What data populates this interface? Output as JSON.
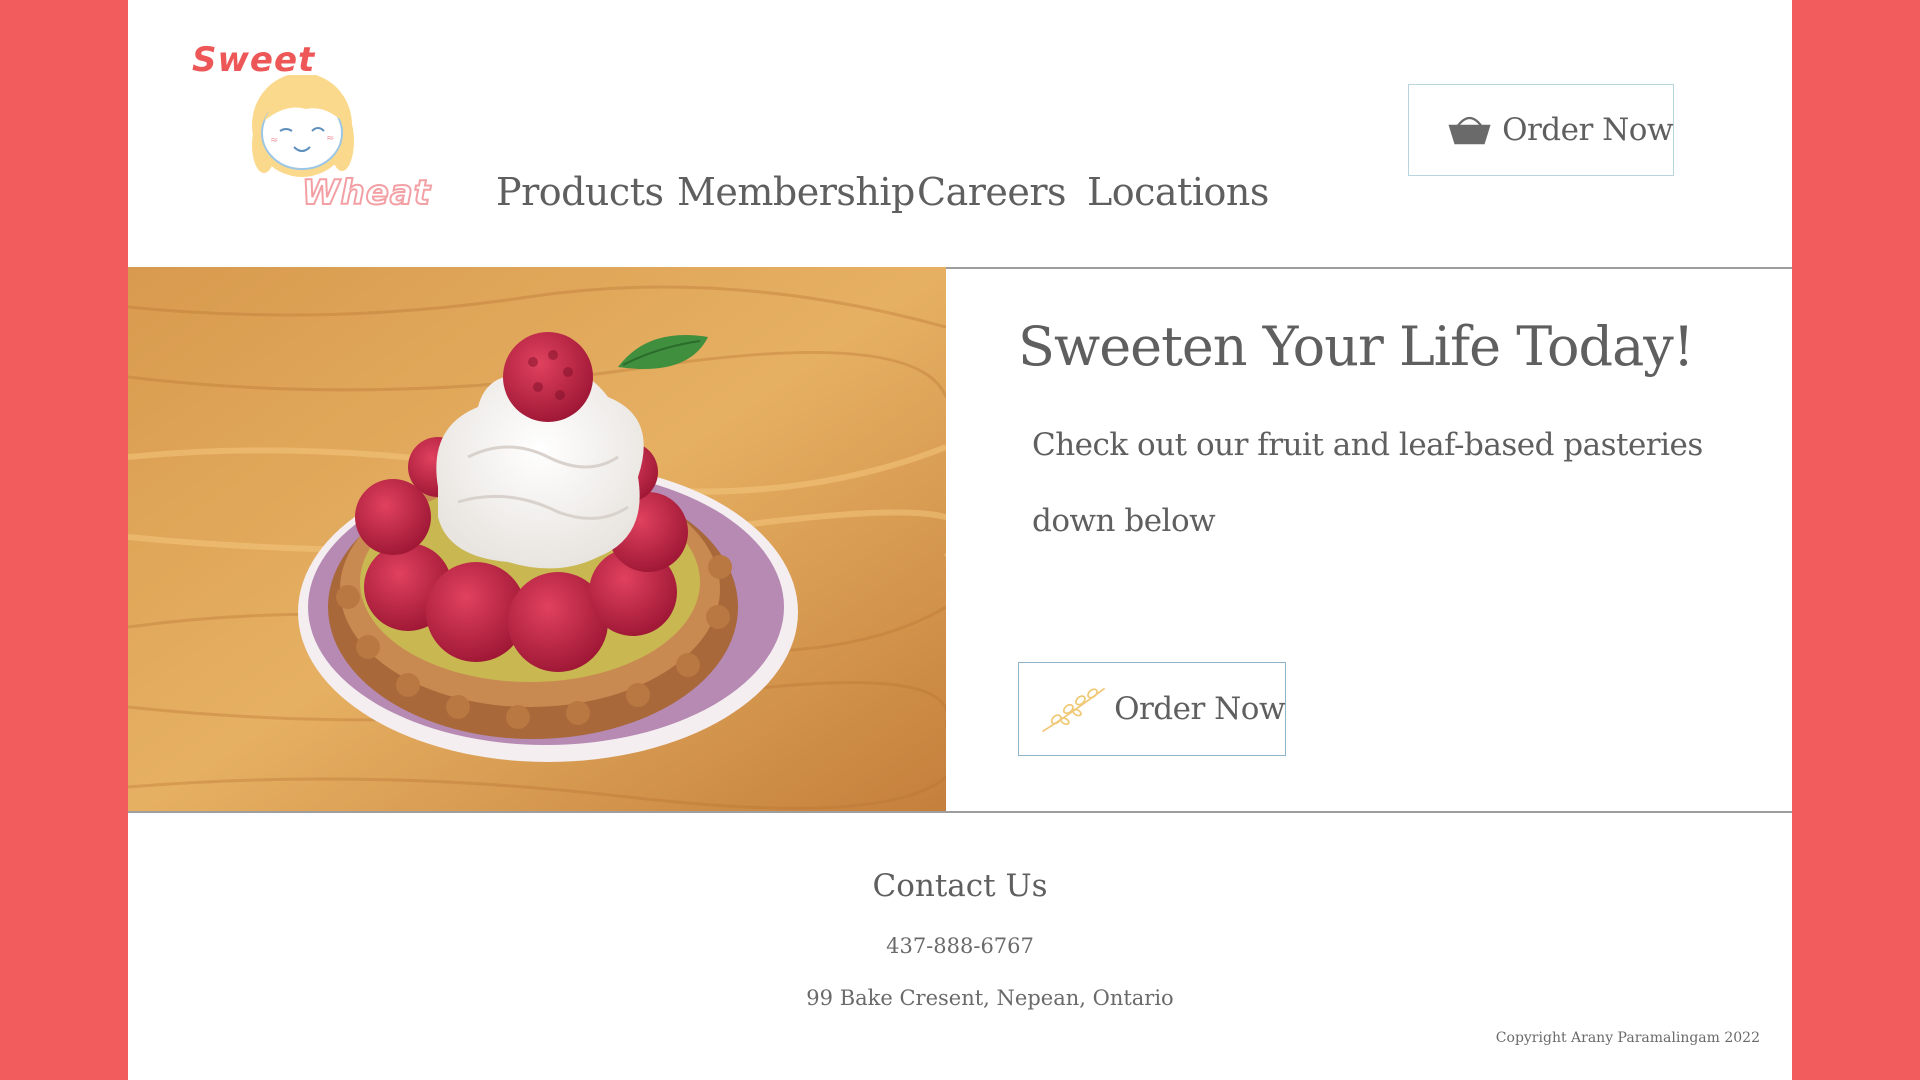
{
  "brand": {
    "top_word": "Sweet",
    "bottom_word": "Wheat"
  },
  "nav": {
    "items": [
      {
        "label": "Products"
      },
      {
        "label": "Membership"
      },
      {
        "label": "Careers"
      },
      {
        "label": "Locations"
      }
    ]
  },
  "header": {
    "order_label": "Order Now",
    "order_icon": "basket-icon"
  },
  "hero": {
    "image": "raspberry-tart-photo",
    "title": "Sweeten Your Life Today!",
    "text": "Check out our fruit and leaf-based pasteries down below",
    "order_label": "Order Now",
    "order_icon": "wheat-sprig-icon"
  },
  "footer": {
    "contact_title": "Contact Us",
    "phone": "437-888-6767",
    "address": "99 Bake Cresent, Nepean, Ontario",
    "copyright": "Copyright Arany Paramalingam 2022"
  },
  "colors": {
    "background": "#f25c5c",
    "page": "#ffffff",
    "text": "#5f5f5f",
    "button_border": "#b8d4df",
    "logo_red": "#ee5757",
    "logo_pink": "#f3a0a5"
  }
}
